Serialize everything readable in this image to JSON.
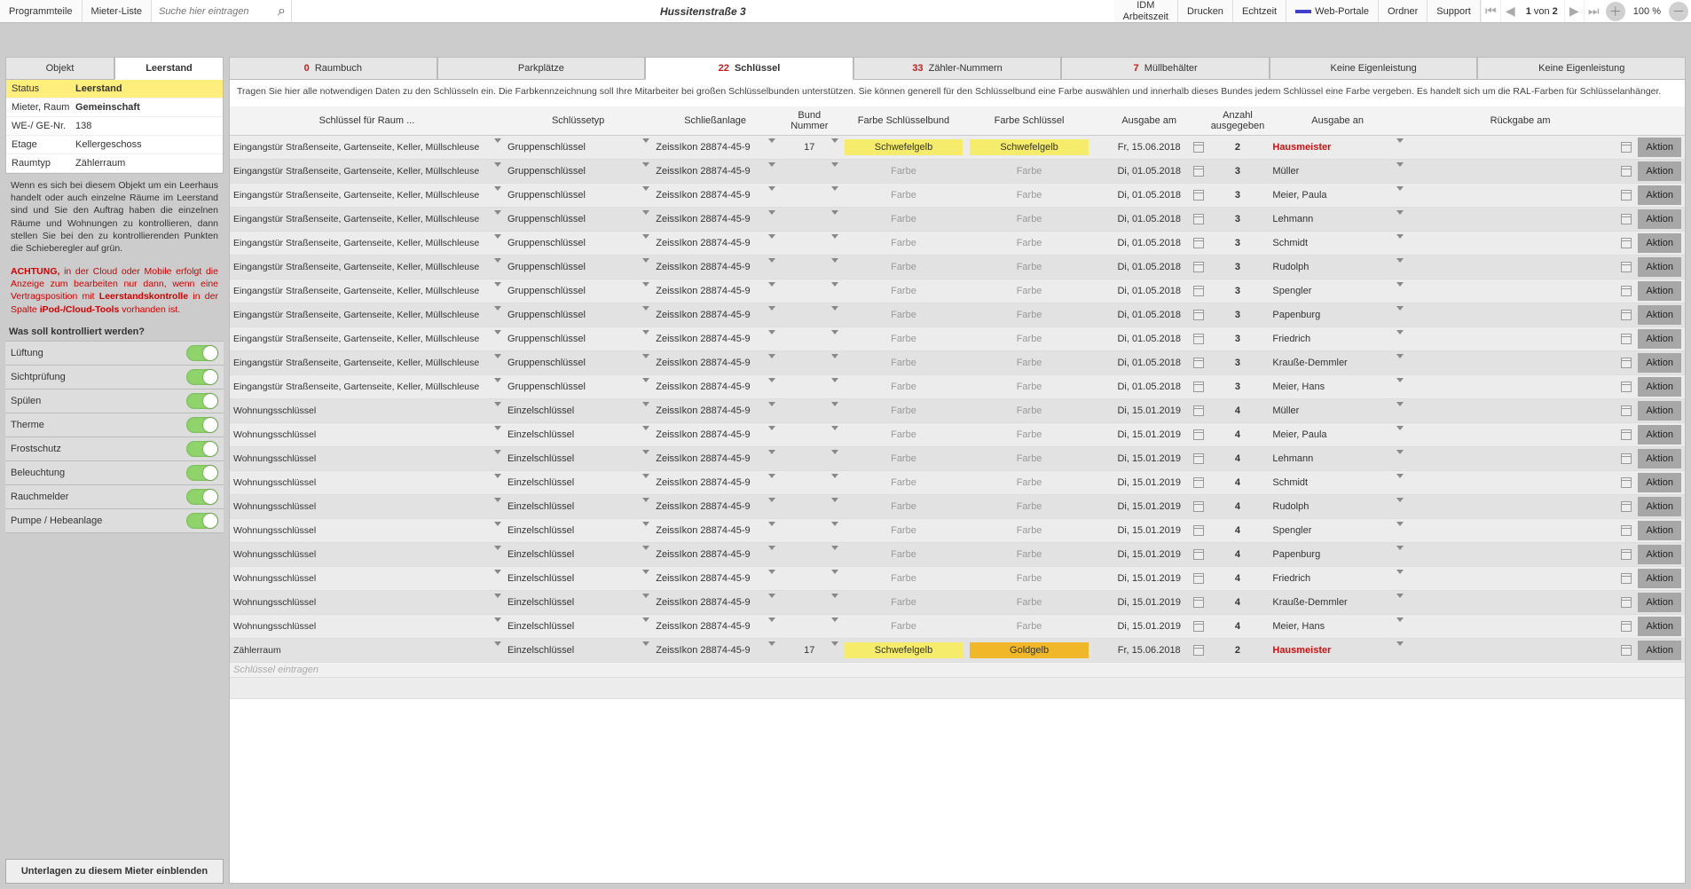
{
  "top": {
    "programmteile": "Programmteile",
    "mieterliste": "Mieter-Liste",
    "search_placeholder": "Suche hier eintragen",
    "title": "Hussitenstraße 3",
    "idm": "IDM\nArbeitszeit",
    "drucken": "Drucken",
    "echtzeit": "Echtzeit",
    "webportale": "Web-Portale",
    "ordner": "Ordner",
    "support": "Support",
    "pager_prefix": "",
    "pager_current": "1",
    "pager_mid": " von ",
    "pager_total": "2",
    "zoom": "100 %"
  },
  "leftTabs": {
    "objekt": "Objekt",
    "leerstand": "Leerstand"
  },
  "kv": {
    "status_k": "Status",
    "status_v": "Leerstand",
    "mieter_k": "Mieter, Raum",
    "mieter_v": "Gemeinschaft",
    "we_k": "WE-/ GE-Nr.",
    "we_v": "138",
    "etage_k": "Etage",
    "etage_v": "Kellergeschoss",
    "raum_k": "Raumtyp",
    "raum_v": "Zählerraum"
  },
  "note1": "Wenn es sich bei diesem Objekt um ein Leerhaus handelt oder auch einzelne Räume im Leerstand sind und Sie den Auftrag haben die einzelnen Räume und Wohnungen zu kontrollieren, dann stellen Sie bei den zu kontrollierenden Punkten die Schieberegler auf grün.",
  "note2_pre": "ACHTUNG,",
  "note2_body": " in der Cloud oder Mobile erfolgt die Anzeige zum bearbeiten nur dann, wenn eine Vertragsposition mit ",
  "note2_ls": "Leerstandskontrolle",
  "note2_body2": " in der Spalte ",
  "note2_tool": "iPod-/Cloud-Tools",
  "note2_end": " vorhanden ist.",
  "ctrl_head": "Was soll kontrolliert werden?",
  "toggles": [
    "Lüftung",
    "Sichtprüfung",
    "Spülen",
    "Therme",
    "Frostschutz",
    "Beleuchtung",
    "Rauchmelder",
    "Pumpe / Hebeanlage"
  ],
  "unterlagen_btn": "Unterlagen zu diesem Mieter einblenden",
  "rtabs": [
    {
      "cnt": "0",
      "label": "Raumbuch",
      "red": true
    },
    {
      "cnt": "",
      "label": "Parkplätze"
    },
    {
      "cnt": "22",
      "label": "Schlüssel",
      "red": true,
      "active": true
    },
    {
      "cnt": "33",
      "label": "Zähler-Nummern",
      "red": true
    },
    {
      "cnt": "7",
      "label": "Müllbehälter",
      "red": true
    },
    {
      "cnt": "",
      "label": "Keine Eigenleistung"
    },
    {
      "cnt": "",
      "label": "Keine Eigenleistung"
    }
  ],
  "instr": "Tragen Sie hier alle notwendigen Daten zu den Schlüsseln ein. Die Farbkennzeichnung soll Ihre Mitarbeiter bei großen Schlüsselbunden unterstützen. Sie können generell für den Schlüsselbund eine Farbe auswählen und innerhalb dieses Bundes jedem Schlüssel eine Farbe vergeben. Es handelt sich um die RAL-Farben für Schlüsselanhänger.",
  "headers": {
    "room": "Schlüssel für Raum ...",
    "typ": "Schlüssetyp",
    "anlage": "Schließanlage",
    "bund": "Bund\nNummer",
    "fb": "Farbe Schlüsselbund",
    "fs": "Farbe Schlüssel",
    "am": "Ausgabe am",
    "anz": "Anzahl\nausgegeben",
    "an": "Ausgabe an",
    "rueck": "Rückgabe am",
    "aktion": "Aktion"
  },
  "farbe_ph": "Farbe",
  "newrow_ph": "Schlüssel eintragen",
  "rows": [
    {
      "room": "Eingangstür Straßenseite, Gartenseite, Keller, Müllschleuse",
      "typ": "Gruppenschlüssel",
      "anlage": "ZeissIkon 28874-45-9",
      "bund": "17",
      "fb": "Schwefelgelb",
      "fbClass": "schwefel",
      "fs": "Schwefelgelb",
      "fsClass": "schwefel",
      "am": "Fr, 15.06.2018",
      "anz": "2",
      "an": "Hausmeister",
      "anRed": true
    },
    {
      "room": "Eingangstür Straßenseite, Gartenseite, Keller, Müllschleuse",
      "typ": "Gruppenschlüssel",
      "anlage": "ZeissIkon 28874-45-9",
      "bund": "",
      "fb": "",
      "fs": "",
      "am": "Di, 01.05.2018",
      "anz": "3",
      "an": "Müller"
    },
    {
      "room": "Eingangstür Straßenseite, Gartenseite, Keller, Müllschleuse",
      "typ": "Gruppenschlüssel",
      "anlage": "ZeissIkon 28874-45-9",
      "bund": "",
      "fb": "",
      "fs": "",
      "am": "Di, 01.05.2018",
      "anz": "3",
      "an": "Meier, Paula"
    },
    {
      "room": "Eingangstür Straßenseite, Gartenseite, Keller, Müllschleuse",
      "typ": "Gruppenschlüssel",
      "anlage": "ZeissIkon 28874-45-9",
      "bund": "",
      "fb": "",
      "fs": "",
      "am": "Di, 01.05.2018",
      "anz": "3",
      "an": "Lehmann"
    },
    {
      "room": "Eingangstür Straßenseite, Gartenseite, Keller, Müllschleuse",
      "typ": "Gruppenschlüssel",
      "anlage": "ZeissIkon 28874-45-9",
      "bund": "",
      "fb": "",
      "fs": "",
      "am": "Di, 01.05.2018",
      "anz": "3",
      "an": "Schmidt"
    },
    {
      "room": "Eingangstür Straßenseite, Gartenseite, Keller, Müllschleuse",
      "typ": "Gruppenschlüssel",
      "anlage": "ZeissIkon 28874-45-9",
      "bund": "",
      "fb": "",
      "fs": "",
      "am": "Di, 01.05.2018",
      "anz": "3",
      "an": "Rudolph"
    },
    {
      "room": "Eingangstür Straßenseite, Gartenseite, Keller, Müllschleuse",
      "typ": "Gruppenschlüssel",
      "anlage": "ZeissIkon 28874-45-9",
      "bund": "",
      "fb": "",
      "fs": "",
      "am": "Di, 01.05.2018",
      "anz": "3",
      "an": "Spengler"
    },
    {
      "room": "Eingangstür Straßenseite, Gartenseite, Keller, Müllschleuse",
      "typ": "Gruppenschlüssel",
      "anlage": "ZeissIkon 28874-45-9",
      "bund": "",
      "fb": "",
      "fs": "",
      "am": "Di, 01.05.2018",
      "anz": "3",
      "an": "Papenburg"
    },
    {
      "room": "Eingangstür Straßenseite, Gartenseite, Keller, Müllschleuse",
      "typ": "Gruppenschlüssel",
      "anlage": "ZeissIkon 28874-45-9",
      "bund": "",
      "fb": "",
      "fs": "",
      "am": "Di, 01.05.2018",
      "anz": "3",
      "an": "Friedrich"
    },
    {
      "room": "Eingangstür Straßenseite, Gartenseite, Keller, Müllschleuse",
      "typ": "Gruppenschlüssel",
      "anlage": "ZeissIkon 28874-45-9",
      "bund": "",
      "fb": "",
      "fs": "",
      "am": "Di, 01.05.2018",
      "anz": "3",
      "an": "Krauße-Demmler"
    },
    {
      "room": "Eingangstür Straßenseite, Gartenseite, Keller, Müllschleuse",
      "typ": "Gruppenschlüssel",
      "anlage": "ZeissIkon 28874-45-9",
      "bund": "",
      "fb": "",
      "fs": "",
      "am": "Di, 01.05.2018",
      "anz": "3",
      "an": "Meier, Hans"
    },
    {
      "room": "Wohnungsschlüssel",
      "typ": "Einzelschlüssel",
      "anlage": "ZeissIkon 28874-45-9",
      "bund": "",
      "fb": "",
      "fs": "",
      "am": "Di, 15.01.2019",
      "anz": "4",
      "an": "Müller"
    },
    {
      "room": "Wohnungsschlüssel",
      "typ": "Einzelschlüssel",
      "anlage": "ZeissIkon 28874-45-9",
      "bund": "",
      "fb": "",
      "fs": "",
      "am": "Di, 15.01.2019",
      "anz": "4",
      "an": "Meier, Paula"
    },
    {
      "room": "Wohnungsschlüssel",
      "typ": "Einzelschlüssel",
      "anlage": "ZeissIkon 28874-45-9",
      "bund": "",
      "fb": "",
      "fs": "",
      "am": "Di, 15.01.2019",
      "anz": "4",
      "an": "Lehmann"
    },
    {
      "room": "Wohnungsschlüssel",
      "typ": "Einzelschlüssel",
      "anlage": "ZeissIkon 28874-45-9",
      "bund": "",
      "fb": "",
      "fs": "",
      "am": "Di, 15.01.2019",
      "anz": "4",
      "an": "Schmidt"
    },
    {
      "room": "Wohnungsschlüssel",
      "typ": "Einzelschlüssel",
      "anlage": "ZeissIkon 28874-45-9",
      "bund": "",
      "fb": "",
      "fs": "",
      "am": "Di, 15.01.2019",
      "anz": "4",
      "an": "Rudolph"
    },
    {
      "room": "Wohnungsschlüssel",
      "typ": "Einzelschlüssel",
      "anlage": "ZeissIkon 28874-45-9",
      "bund": "",
      "fb": "",
      "fs": "",
      "am": "Di, 15.01.2019",
      "anz": "4",
      "an": "Spengler"
    },
    {
      "room": "Wohnungsschlüssel",
      "typ": "Einzelschlüssel",
      "anlage": "ZeissIkon 28874-45-9",
      "bund": "",
      "fb": "",
      "fs": "",
      "am": "Di, 15.01.2019",
      "anz": "4",
      "an": "Papenburg"
    },
    {
      "room": "Wohnungsschlüssel",
      "typ": "Einzelschlüssel",
      "anlage": "ZeissIkon 28874-45-9",
      "bund": "",
      "fb": "",
      "fs": "",
      "am": "Di, 15.01.2019",
      "anz": "4",
      "an": "Friedrich"
    },
    {
      "room": "Wohnungsschlüssel",
      "typ": "Einzelschlüssel",
      "anlage": "ZeissIkon 28874-45-9",
      "bund": "",
      "fb": "",
      "fs": "",
      "am": "Di, 15.01.2019",
      "anz": "4",
      "an": "Krauße-Demmler"
    },
    {
      "room": "Wohnungsschlüssel",
      "typ": "Einzelschlüssel",
      "anlage": "ZeissIkon 28874-45-9",
      "bund": "",
      "fb": "",
      "fs": "",
      "am": "Di, 15.01.2019",
      "anz": "4",
      "an": "Meier, Hans"
    },
    {
      "room": "Zählerraum",
      "typ": "Einzelschlüssel",
      "anlage": "ZeissIkon 28874-45-9",
      "bund": "17",
      "fb": "Schwefelgelb",
      "fbClass": "schwefel",
      "fs": "Goldgelb",
      "fsClass": "gold",
      "am": "Fr, 15.06.2018",
      "anz": "2",
      "an": "Hausmeister",
      "anRed": true
    }
  ]
}
